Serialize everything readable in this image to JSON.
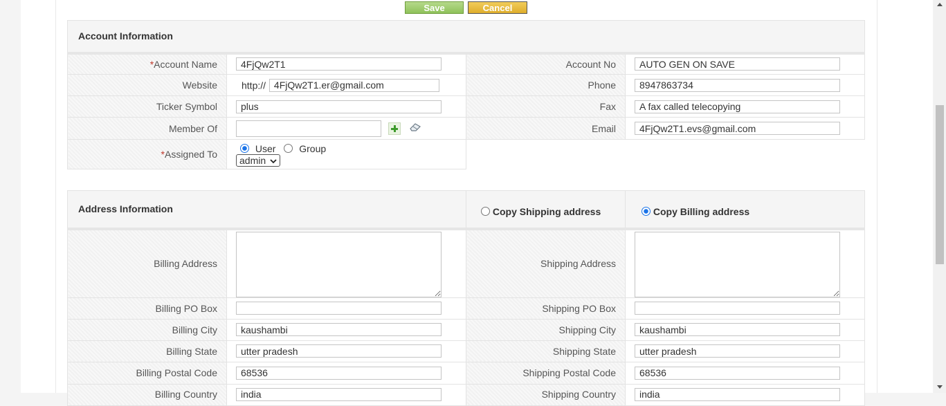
{
  "toolbar": {
    "save_label": "Save",
    "cancel_label": "Cancel"
  },
  "account": {
    "heading": "Account Information",
    "required_mark": "*",
    "account_name_label": "Account Name",
    "account_name": "4FjQw2T1",
    "account_no_label": "Account No",
    "account_no": "AUTO GEN ON SAVE",
    "website_label": "Website",
    "website_prefix": "http://",
    "website": "4FjQw2T1.er@gmail.com",
    "phone_label": "Phone",
    "phone": "8947863734",
    "ticker_label": "Ticker Symbol",
    "ticker": "plus",
    "fax_label": "Fax",
    "fax": "A fax called telecopying",
    "member_of_label": "Member Of",
    "member_of": "",
    "email_label": "Email",
    "email": "4FjQw2T1.evs@gmail.com",
    "assigned_to_label": "Assigned To",
    "assign_user_label": "User",
    "assign_group_label": "Group",
    "assigned_user": "admin"
  },
  "address": {
    "heading": "Address Information",
    "copy_shipping_label": "Copy Shipping address",
    "copy_billing_label": "Copy Billing address",
    "billing_address_label": "Billing Address",
    "billing_address": "",
    "shipping_address_label": "Shipping Address",
    "shipping_address": "",
    "billing_po_label": "Billing PO Box",
    "billing_po": "",
    "shipping_po_label": "Shipping PO Box",
    "shipping_po": "",
    "billing_city_label": "Billing City",
    "billing_city": "kaushambi",
    "shipping_city_label": "Shipping City",
    "shipping_city": "kaushambi",
    "billing_state_label": "Billing State",
    "billing_state": "utter pradesh",
    "shipping_state_label": "Shipping State",
    "shipping_state": "utter pradesh",
    "billing_postal_label": "Billing Postal Code",
    "billing_postal": "68536",
    "shipping_postal_label": "Shipping Postal Code",
    "shipping_postal": "68536",
    "billing_country_label": "Billing Country",
    "billing_country": "india",
    "shipping_country_label": "Shipping Country",
    "shipping_country": "india"
  },
  "icons": {
    "add": "plus-icon",
    "clear": "eraser-icon"
  }
}
